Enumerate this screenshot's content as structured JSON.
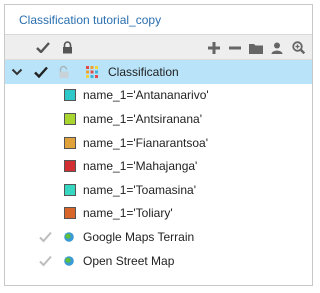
{
  "panel": {
    "title": "Classification tutorial_copy"
  },
  "toolbar": {
    "tools": [
      "add-icon",
      "remove-icon",
      "folder-icon",
      "user-icon",
      "zoom-in-icon"
    ]
  },
  "layer": {
    "label": "Classification",
    "expanded": true,
    "visible": true,
    "locked": false
  },
  "classes": [
    {
      "label": "name_1='Antananarivo'",
      "color": "#2ec8c8"
    },
    {
      "label": "name_1='Antsiranana'",
      "color": "#a8d530"
    },
    {
      "label": "name_1='Fianarantsoa'",
      "color": "#e0a23a"
    },
    {
      "label": "name_1='Mahajanga'",
      "color": "#d22f34"
    },
    {
      "label": "name_1='Toamasina'",
      "color": "#37d6c1"
    },
    {
      "label": "name_1='Toliary'",
      "color": "#d8662a"
    }
  ],
  "basemaps": [
    {
      "label": "Google Maps Terrain"
    },
    {
      "label": "Open Street Map"
    }
  ],
  "colors": {
    "title": "#2a6fb0",
    "selected_row": "#b9e3f8",
    "toolbar_bg": "#eeeeee"
  }
}
